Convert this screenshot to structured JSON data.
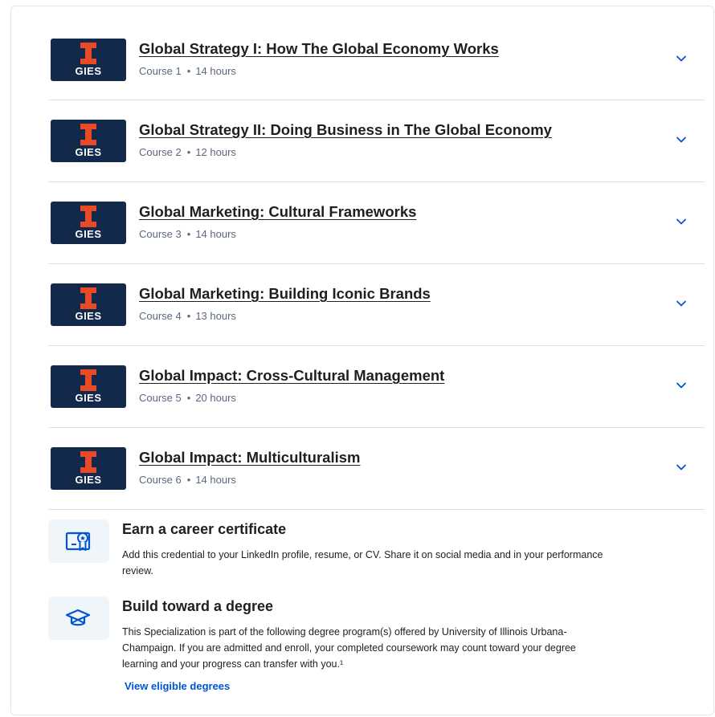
{
  "logo": {
    "text": "GIES",
    "letter": "I"
  },
  "courses": [
    {
      "title": "Global Strategy I: How The Global Economy Works",
      "course": "Course 1",
      "hours": "14 hours"
    },
    {
      "title": "Global Strategy II: Doing Business in The Global Economy",
      "course": "Course 2",
      "hours": "12 hours"
    },
    {
      "title": "Global Marketing: Cultural Frameworks",
      "course": "Course 3",
      "hours": "14 hours"
    },
    {
      "title": "Global Marketing: Building Iconic Brands",
      "course": "Course 4",
      "hours": "13 hours"
    },
    {
      "title": "Global Impact: Cross-Cultural Management",
      "course": "Course 5",
      "hours": "20 hours"
    },
    {
      "title": "Global Impact: Multiculturalism",
      "course": "Course 6",
      "hours": "14 hours"
    }
  ],
  "certificate": {
    "icon": "certificate-icon",
    "title": "Earn a career certificate",
    "description": "Add this credential to your LinkedIn profile, resume, or CV. Share it on social media and in your performance review."
  },
  "degree": {
    "icon": "graduation-cap-icon",
    "title": "Build toward a degree",
    "description": "This Specialization is part of the following degree program(s) offered by University of Illinois Urbana-Champaign. If you are admitted and enroll, your completed coursework may count toward your degree learning and your progress can transfer with you.¹",
    "link": "View eligible degrees"
  },
  "colors": {
    "logo_bg": "#13294b",
    "logo_accent": "#e84a27",
    "link": "#0056d2",
    "chevron": "#0056d2",
    "icon_tile": "#f0f5fa"
  }
}
